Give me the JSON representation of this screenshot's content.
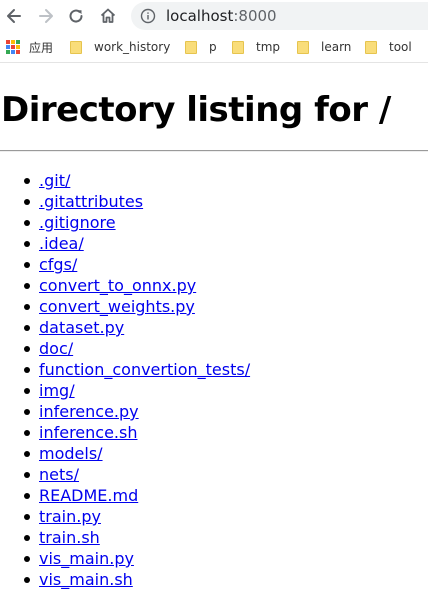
{
  "browser": {
    "url_host": "localhost",
    "url_port": ":8000",
    "back_icon": "arrow-left-icon",
    "forward_icon": "arrow-right-icon",
    "reload_icon": "reload-icon",
    "home_icon": "home-icon",
    "info_icon": "info-icon"
  },
  "bookmarks": {
    "apps_label": "应用",
    "items": [
      {
        "label": "work_history",
        "icon": "folder-icon"
      },
      {
        "label": "p",
        "icon": "folder-icon"
      },
      {
        "label": "tmp",
        "icon": "folder-icon"
      },
      {
        "label": "learn",
        "icon": "folder-icon"
      },
      {
        "label": "tool",
        "icon": "folder-icon"
      }
    ]
  },
  "page": {
    "title": "Directory listing for /",
    "entries": [
      ".git/",
      ".gitattributes",
      ".gitignore",
      ".idea/",
      "cfgs/",
      "convert_to_onnx.py",
      "convert_weights.py",
      "dataset.py",
      "doc/",
      "function_convertion_tests/",
      "img/",
      "inference.py",
      "inference.sh",
      "models/",
      "nets/",
      "README.md",
      "train.py",
      "train.sh",
      "vis_main.py",
      "vis_main.sh"
    ]
  },
  "colors": {
    "link": "#0000ee",
    "folder": "#f9dd7a",
    "address_bar_bg": "#f1f3f4",
    "apps_grid": [
      "#ea4335",
      "#fbbc05",
      "#34a853",
      "#4285f4",
      "#ea4335",
      "#fbbc05",
      "#34a853",
      "#4285f4",
      "#ea4335"
    ]
  }
}
